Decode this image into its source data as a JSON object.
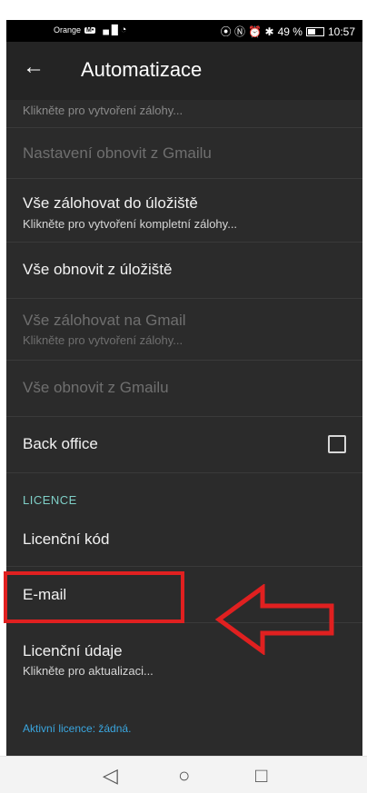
{
  "status_bar": {
    "carrier": "Orange",
    "carrier_badge": "M•",
    "signal": "▗▖█",
    "wifi": "◔",
    "icons": "⦿ Ⓝ ⏰ ✱",
    "battery_percent": "49 %",
    "battery_level": 0.49,
    "time": "10:57"
  },
  "app_bar": {
    "back_icon": "←",
    "title": "Automatizace"
  },
  "items": {
    "partial": {
      "subtitle": "Klikněte pro vytvoření zálohy..."
    },
    "restore_gmail_settings": {
      "title": "Nastavení obnovit z Gmailu",
      "disabled": true
    },
    "backup_all_storage": {
      "title": "Vše zálohovat do úložiště",
      "subtitle": "Klikněte pro vytvoření kompletní zálohy..."
    },
    "restore_all_storage": {
      "title": "Vše obnovit z úložiště"
    },
    "backup_all_gmail": {
      "title": "Vše zálohovat na Gmail",
      "subtitle": "Klikněte pro vytvoření zálohy...",
      "disabled": true
    },
    "restore_all_gmail": {
      "title": "Vše obnovit z Gmailu",
      "disabled": true
    },
    "back_office": {
      "title": "Back office",
      "checked": false
    },
    "licence_section": "LICENCE",
    "licence_code": {
      "title": "Licenční kód"
    },
    "email": {
      "title": "E-mail"
    },
    "licence_details": {
      "title": "Licenční údaje",
      "subtitle": "Klikněte pro aktualizaci..."
    },
    "active_licence": "Aktivní licence: žádná."
  },
  "annotation": {
    "highlight_color": "#e02020",
    "arrow_icon": "left-arrow-outline-icon"
  },
  "nav_bar": {
    "back": "◁",
    "home": "○",
    "recents": "□"
  },
  "colors": {
    "background": "#2b2b2b",
    "app_bar": "#242424",
    "accent_section": "#7fd0c8",
    "link": "#3aa6df",
    "disabled_text": "#6f6f6f"
  }
}
